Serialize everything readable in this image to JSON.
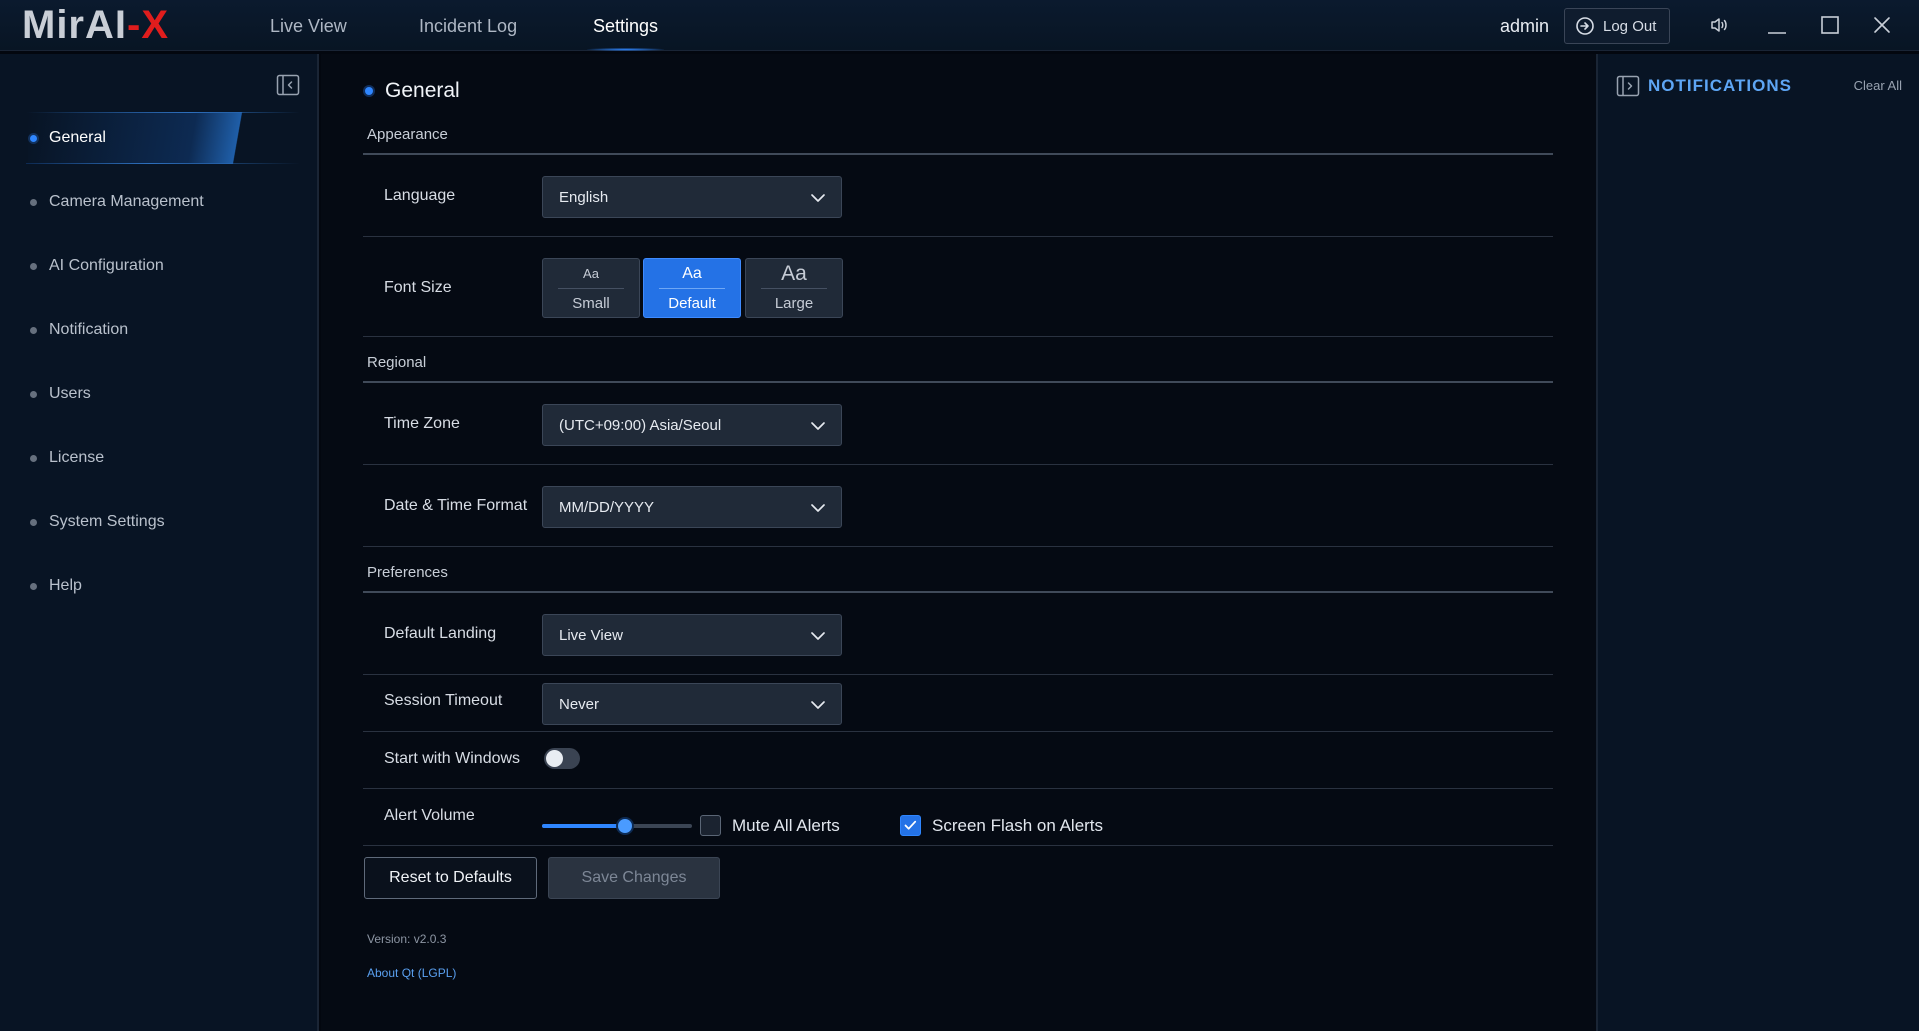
{
  "app": {
    "logo_part1": "MirAI",
    "logo_part2": "-X"
  },
  "nav": {
    "tabs": [
      {
        "label": "Live View"
      },
      {
        "label": "Incident Log"
      },
      {
        "label": "Settings",
        "active": true
      }
    ]
  },
  "header": {
    "username": "admin",
    "logout_label": "Log Out"
  },
  "sidebar": {
    "items": [
      {
        "label": "General",
        "active": true
      },
      {
        "label": "Camera Management"
      },
      {
        "label": "AI Configuration"
      },
      {
        "label": "Notification"
      },
      {
        "label": "Users"
      },
      {
        "label": "License"
      },
      {
        "label": "System Settings"
      },
      {
        "label": "Help"
      }
    ]
  },
  "main": {
    "title": "General",
    "sections": {
      "appearance": "Appearance",
      "regional": "Regional",
      "preferences": "Preferences"
    },
    "language": {
      "label": "Language",
      "value": "English"
    },
    "font_size": {
      "label": "Font Size",
      "options": [
        {
          "sample": "Aa",
          "label": "Small"
        },
        {
          "sample": "Aa",
          "label": "Default",
          "selected": true
        },
        {
          "sample": "Aa",
          "label": "Large"
        }
      ]
    },
    "time_zone": {
      "label": "Time Zone",
      "value": "(UTC+09:00) Asia/Seoul"
    },
    "date_format": {
      "label": "Date & Time Format",
      "value": "MM/DD/YYYY"
    },
    "default_landing": {
      "label": "Default Landing",
      "value": "Live View"
    },
    "session_timeout": {
      "label": "Session Timeout",
      "value": "Never"
    },
    "start_with_windows": {
      "label": "Start with Windows",
      "enabled": false
    },
    "alert_volume": {
      "label": "Alert Volume",
      "level_fraction": 0.55
    },
    "mute_all_alerts": {
      "label": "Mute All Alerts",
      "checked": false
    },
    "screen_flash": {
      "label": "Screen Flash on Alerts",
      "checked": true
    },
    "buttons": {
      "reset": "Reset to Defaults",
      "save": "Save Changes"
    },
    "version": "Version: v2.0.3",
    "about": "About Qt (LGPL)"
  },
  "notifications": {
    "title": "NOTIFICATIONS",
    "clear_all": "Clear All"
  },
  "colors": {
    "accent": "#2f86ff",
    "active_button": "#2472e6",
    "logo_red": "#e01d1d",
    "notif_title": "#5ea6f5"
  }
}
